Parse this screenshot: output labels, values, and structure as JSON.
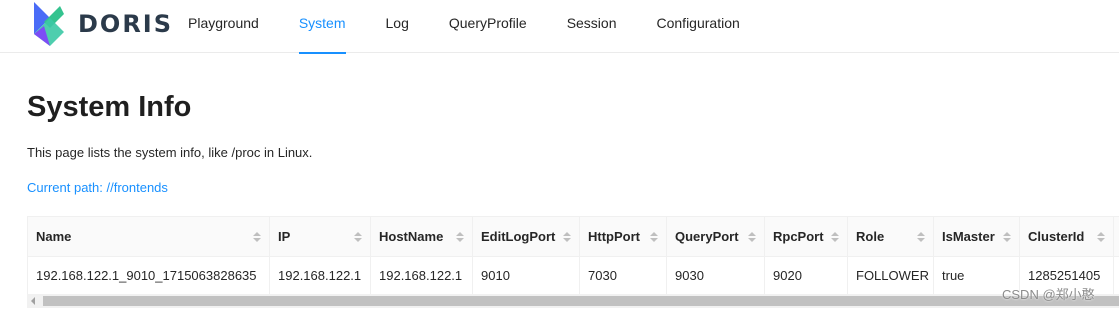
{
  "brand": {
    "name": "DORIS"
  },
  "nav": {
    "items": [
      {
        "label": "Playground"
      },
      {
        "label": "System"
      },
      {
        "label": "Log"
      },
      {
        "label": "QueryProfile"
      },
      {
        "label": "Session"
      },
      {
        "label": "Configuration"
      }
    ],
    "active": "System"
  },
  "page": {
    "title": "System Info",
    "description": "This page lists the system info, like /proc in Linux.",
    "current_path": "Current path: //frontends"
  },
  "table": {
    "columns": [
      "Name",
      "IP",
      "HostName",
      "EditLogPort",
      "HttpPort",
      "QueryPort",
      "RpcPort",
      "Role",
      "IsMaster",
      "ClusterId",
      ""
    ],
    "rows": [
      [
        "192.168.122.1_9010_1715063828635",
        "192.168.122.1",
        "192.168.122.1",
        "9010",
        "7030",
        "9030",
        "9020",
        "FOLLOWER",
        "true",
        "1285251405",
        ""
      ]
    ]
  },
  "watermark": "CSDN @郑小憨",
  "colors": {
    "accent": "#1890ff",
    "logo_blue": "#4a6cf7",
    "logo_green": "#34c38f",
    "logo_purple": "#7d4df5"
  }
}
